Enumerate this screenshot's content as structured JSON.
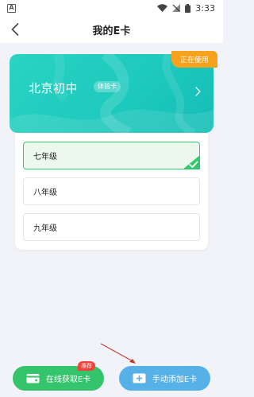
{
  "status_bar": {
    "time": "3:33",
    "notification_icon": "A"
  },
  "header": {
    "title": "我的E卡"
  },
  "card": {
    "school": "北京初中",
    "tag": "体验卡",
    "status": "正在使用"
  },
  "grades": {
    "items": [
      {
        "label": "七年级",
        "selected": true
      },
      {
        "label": "八年级",
        "selected": false
      },
      {
        "label": "九年级",
        "selected": false
      }
    ]
  },
  "actions": {
    "online_label": "在线获取E卡",
    "online_badge": "推荐",
    "manual_label": "手动添加E卡"
  },
  "colors": {
    "card": "#1ec9bd",
    "in_use": "#f7a21c",
    "online_button": "#34c46c",
    "manual_button": "#56b1e8",
    "badge": "#f0433a",
    "selected_border": "#34c86e"
  }
}
